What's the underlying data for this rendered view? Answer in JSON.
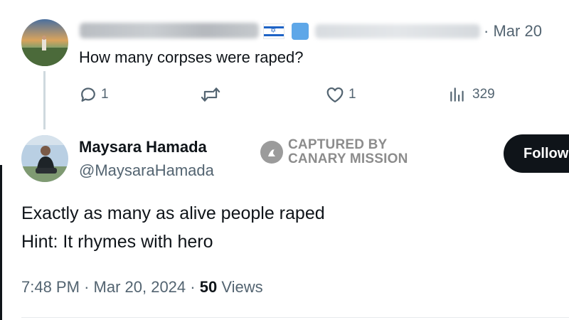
{
  "reply_tweet": {
    "date": "Mar 20",
    "text": "How many corpses were raped?",
    "actions": {
      "replies": "1",
      "retweets": "",
      "likes": "1",
      "views": "329"
    }
  },
  "main_tweet": {
    "author_name": "Maysara Hamada",
    "author_handle": "@MaysaraHamada",
    "follow_label": "Follow",
    "text_lines": [
      "Exactly as many as alive people raped",
      "Hint: It rhymes with hero"
    ],
    "time": "7:48 PM",
    "date": "Mar 20, 2024",
    "views_count": "50",
    "views_label": "Views"
  },
  "watermark": {
    "line1": "CAPTURED BY",
    "line2": "CANARY MISSION"
  },
  "colors": {
    "text_primary": "#0f1419",
    "text_secondary": "#536471",
    "thread_line": "#cfd9de",
    "follow_bg": "#0f1419",
    "watermark": "#8c8c8c"
  }
}
